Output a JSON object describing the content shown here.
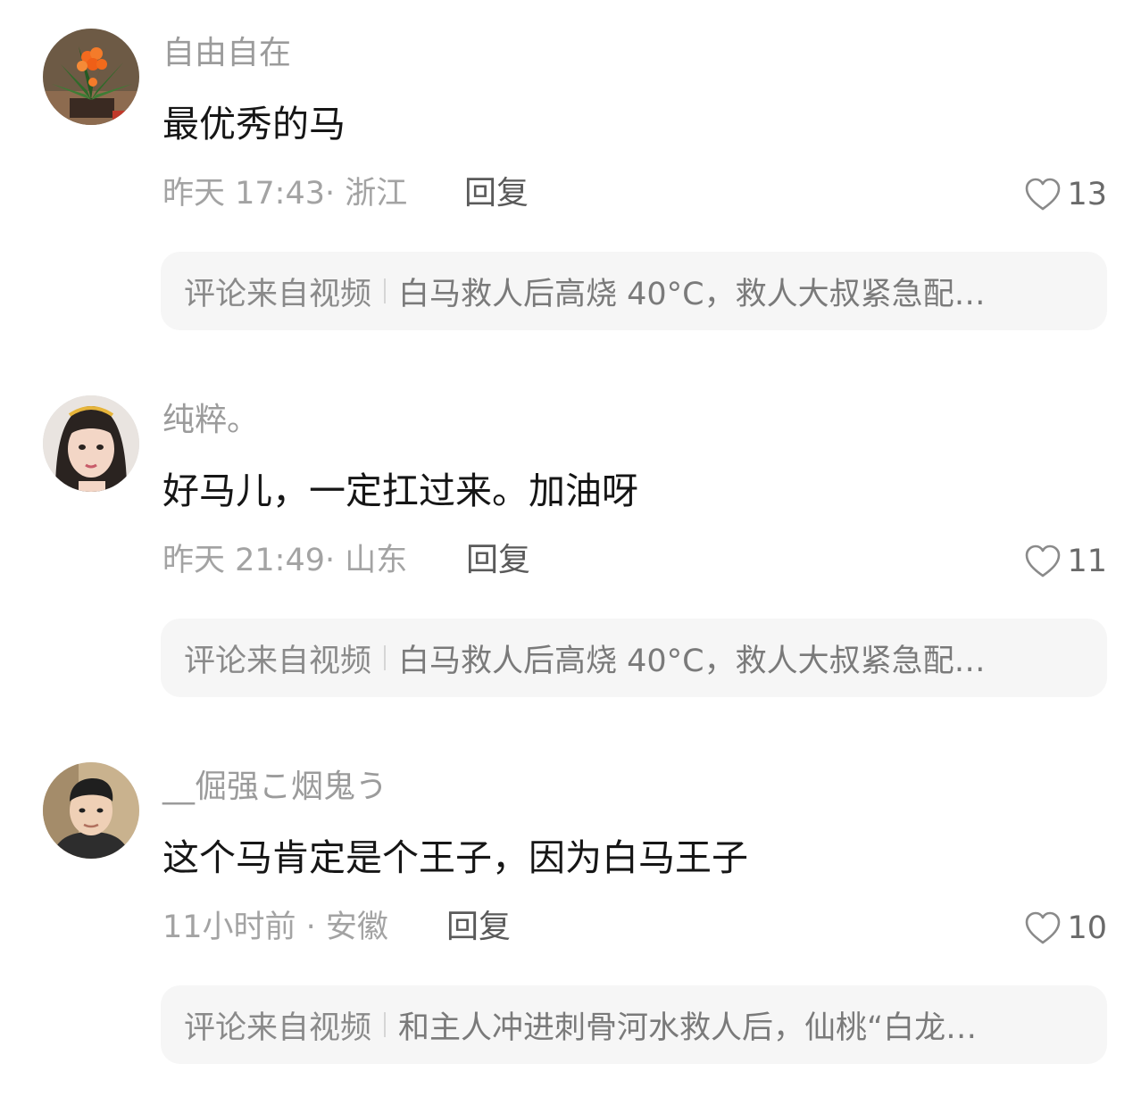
{
  "comments": [
    {
      "username": "自由自在",
      "text": "最优秀的马",
      "meta": "昨天 17:43· 浙江",
      "reply_label": "回复",
      "likes": "13",
      "source_label": "评论来自视频",
      "source_title": "白马救人后高烧 40°C，救人大叔紧急配…",
      "avatar_icon": "flower-avatar"
    },
    {
      "username": "纯粹。",
      "text": "好马儿，一定扛过来。加油呀",
      "meta": "昨天 21:49· 山东",
      "reply_label": "回复",
      "likes": "11",
      "source_label": "评论来自视频",
      "source_title": "白马救人后高烧 40°C，救人大叔紧急配…",
      "avatar_icon": "girl-avatar"
    },
    {
      "username": "__倔强こ烟鬼う",
      "text": "这个马肯定是个王子，因为白马王子",
      "meta": "11小时前 · 安徽",
      "reply_label": "回复",
      "likes": "10",
      "source_label": "评论来自视频",
      "source_title": "和主人冲进刺骨河水救人后，仙桃“白龙…",
      "avatar_icon": "boy-avatar"
    }
  ],
  "colors": {
    "username": "#9b9b9b",
    "text": "#161616",
    "meta": "#a3a3a3",
    "reply": "#5a5a5a",
    "source_bg": "#f6f6f6"
  }
}
